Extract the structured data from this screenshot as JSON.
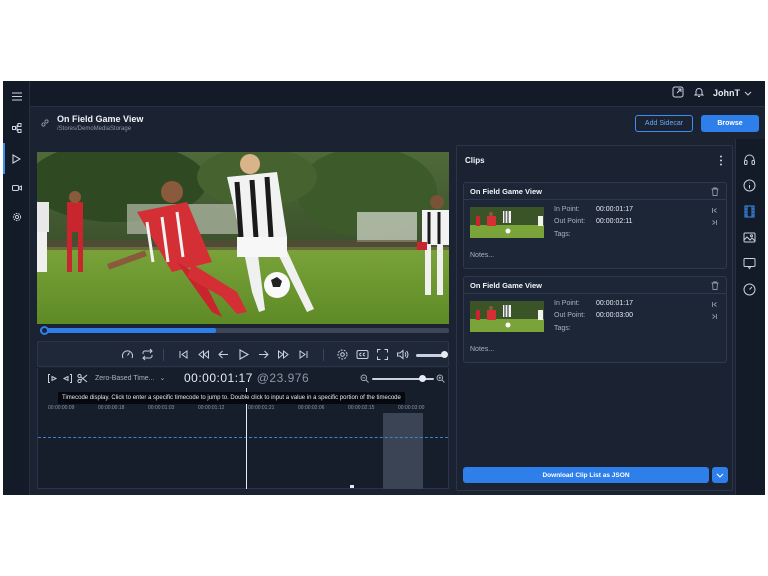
{
  "topbar": {
    "user_name": "JohnT",
    "icons": [
      "open-external-icon",
      "bell-icon",
      "chevron-down-icon"
    ]
  },
  "left_rail": {
    "icons": [
      "menu-icon",
      "hierarchy-icon",
      "play-icon",
      "camera-icon",
      "gear-icon"
    ],
    "active": "play-icon"
  },
  "header": {
    "title": "On Field Game View",
    "path": "/Stores/DemoMediaStorage",
    "add_sidecar_label": "Add Sidecar",
    "browse_label": "Browse"
  },
  "player": {
    "progress": 0.43
  },
  "timeline": {
    "timebase_label": "Zero-Based Time...",
    "timecode": "00:00:01:17",
    "framerate": "@23.976",
    "tooltip": "Timecode display. Click to enter a specific timecode to jump to. Double click to input a value in a specific portion of the timecode",
    "ruler_ticks": [
      "00:00:00:09",
      "00:00:00:18",
      "00:00:01:03",
      "00:00:01:12",
      "00:00:01:21",
      "00:00:02:06",
      "00:00:02:15",
      "00:00:03:00"
    ],
    "zoom_level": 0.75
  },
  "clips_panel": {
    "title": "Clips",
    "in_label": "In Point:",
    "out_label": "Out Point:",
    "tags_label": "Tags:",
    "notes_placeholder": "Notes...",
    "clips": [
      {
        "title": "On Field Game View",
        "in_point": "00:00:01:17",
        "out_point": "00:00:02:11"
      },
      {
        "title": "On Field Game View",
        "in_point": "00:00:01:17",
        "out_point": "00:00:03:00"
      }
    ],
    "download_label": "Download Clip List as JSON"
  },
  "right_rail": {
    "icons": [
      "headphones-icon",
      "info-icon",
      "film-icon",
      "image-icon",
      "comment-icon",
      "gauge-icon"
    ],
    "active": "film-icon"
  },
  "colors": {
    "accent": "#2f7fea",
    "background": "#1b2333",
    "rail": "#141b28"
  }
}
